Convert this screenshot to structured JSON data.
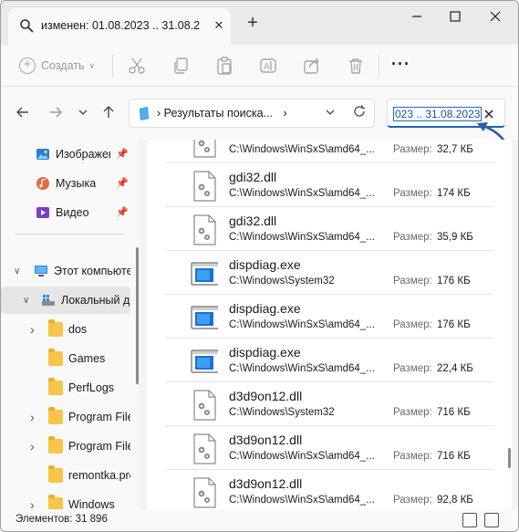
{
  "tab": {
    "title": "изменен: 01.08.2023 .. 31.08.2",
    "close": "✕",
    "new_tab": "+"
  },
  "window_controls": {
    "minimize": "—",
    "maximize": "☐",
    "close": "✕"
  },
  "commandbar": {
    "create_label": "Создать",
    "more_label": "···"
  },
  "address": {
    "text": "Результаты поиска...",
    "search_value": "023 .. 31.08.2023",
    "separator": "›"
  },
  "sidebar": {
    "items": [
      {
        "label": "Изображения",
        "icon": "pictures-icon",
        "pinned": true
      },
      {
        "label": "Музыка",
        "icon": "music-icon",
        "pinned": true
      },
      {
        "label": "Видео",
        "icon": "video-icon",
        "pinned": true
      },
      {
        "label": "Этот компьютер",
        "icon": "this-pc-icon",
        "expander": "∨"
      },
      {
        "label": "Локальный диск",
        "icon": "local-disk-icon",
        "expander": "∨"
      },
      {
        "label": "dos",
        "icon": "folder-icon",
        "expander": "›"
      },
      {
        "label": "Games",
        "icon": "folder-icon"
      },
      {
        "label": "PerfLogs",
        "icon": "folder-icon"
      },
      {
        "label": "Program Files",
        "icon": "folder-icon",
        "expander": "›"
      },
      {
        "label": "Program Files",
        "icon": "folder-icon",
        "expander": "›"
      },
      {
        "label": "remontka.pro",
        "icon": "folder-icon"
      },
      {
        "label": "Windows",
        "icon": "folder-icon",
        "expander": "›"
      }
    ]
  },
  "files": [
    {
      "name": "",
      "path": "C:\\Windows\\WinSxS\\amd64_...",
      "size_label": "Размер:",
      "size": "32,7 КБ",
      "icon": "dll-file-icon"
    },
    {
      "name": "gdi32.dll",
      "path": "C:\\Windows\\WinSxS\\amd64_...",
      "size_label": "Размер:",
      "size": "174 КБ",
      "icon": "dll-file-icon"
    },
    {
      "name": "gdi32.dll",
      "path": "C:\\Windows\\WinSxS\\amd64_...",
      "size_label": "Размер:",
      "size": "35,9 КБ",
      "icon": "dll-file-icon"
    },
    {
      "name": "dispdiag.exe",
      "path": "C:\\Windows\\System32",
      "size_label": "Размер:",
      "size": "176 КБ",
      "icon": "exe-file-icon"
    },
    {
      "name": "dispdiag.exe",
      "path": "C:\\Windows\\WinSxS\\amd64_...",
      "size_label": "Размер:",
      "size": "176 КБ",
      "icon": "exe-file-icon"
    },
    {
      "name": "dispdiag.exe",
      "path": "C:\\Windows\\WinSxS\\amd64_...",
      "size_label": "Размер:",
      "size": "22,4 КБ",
      "icon": "exe-file-icon"
    },
    {
      "name": "d3d9on12.dll",
      "path": "C:\\Windows\\System32",
      "size_label": "Размер:",
      "size": "716 КБ",
      "icon": "dll-file-icon"
    },
    {
      "name": "d3d9on12.dll",
      "path": "C:\\Windows\\WinSxS\\amd64_...",
      "size_label": "Размер:",
      "size": "716 КБ",
      "icon": "dll-file-icon"
    },
    {
      "name": "d3d9on12.dll",
      "path": "C:\\Windows\\WinSxS\\amd64_...",
      "size_label": "Размер:",
      "size": "92,8 КБ",
      "icon": "dll-file-icon"
    }
  ],
  "status": {
    "text": "Элементов: 31 896"
  },
  "colors": {
    "accent": "#1c63b9",
    "folder": "#f7c54a",
    "annotation_arrow": "#2c5fa0"
  }
}
